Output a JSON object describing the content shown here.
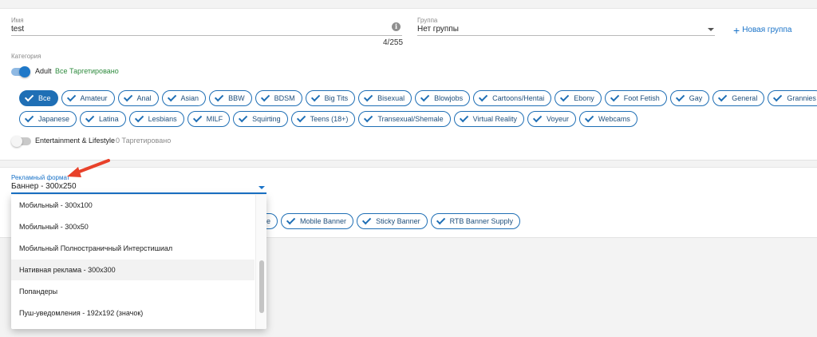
{
  "name_field": {
    "label": "Имя",
    "value": "test",
    "counter": "4/255",
    "info_icon": "info-icon"
  },
  "group_field": {
    "label": "Группа",
    "value": "Нет группы"
  },
  "new_group": {
    "icon": "plus-icon",
    "label": "Новая группа"
  },
  "categories": {
    "title": "Категория",
    "adult": {
      "label": "Adult",
      "status": "Все Таргетировано",
      "enabled": true,
      "row1": [
        "Все",
        "Amateur",
        "Anal",
        "Asian",
        "BBW",
        "BDSM",
        "Big Tits",
        "Bisexual",
        "Blowjobs",
        "Cartoons/Hentai",
        "Ebony",
        "Foot Fetish",
        "Gay",
        "General",
        "Grannies"
      ],
      "row2": [
        "Japanese",
        "Latina",
        "Lesbians",
        "MILF",
        "Squirting",
        "Teens (18+)",
        "Transexual/Shemale",
        "Virtual Reality",
        "Voyeur",
        "Webcams"
      ],
      "selected": "Все"
    },
    "entertainment": {
      "label": "Entertainment & Lifestyle",
      "status": "0 Таргетировано",
      "enabled": false
    }
  },
  "ad_format": {
    "label": "Рекламный формат",
    "value": "Баннер - 300x250",
    "visible_chips": [
      "e",
      "Mobile Banner",
      "Sticky Banner",
      "RTB Banner Supply"
    ],
    "options": [
      "Мобильный - 300x100",
      "Мобильный - 300x50",
      "Мобильный Полностраничный Интерстишиал",
      "Нативная реклама - 300x300",
      "Попандеры",
      "Пуш-уведомления - 192x192 (значок)"
    ],
    "hovered_option": "Нативная реклама - 300x300"
  },
  "colors": {
    "accent": "#1f6fb5",
    "link": "#1a73c8",
    "status_green": "#2e8b3e",
    "status_gray": "#8a8a8a",
    "annotation_arrow": "#e8412a"
  }
}
